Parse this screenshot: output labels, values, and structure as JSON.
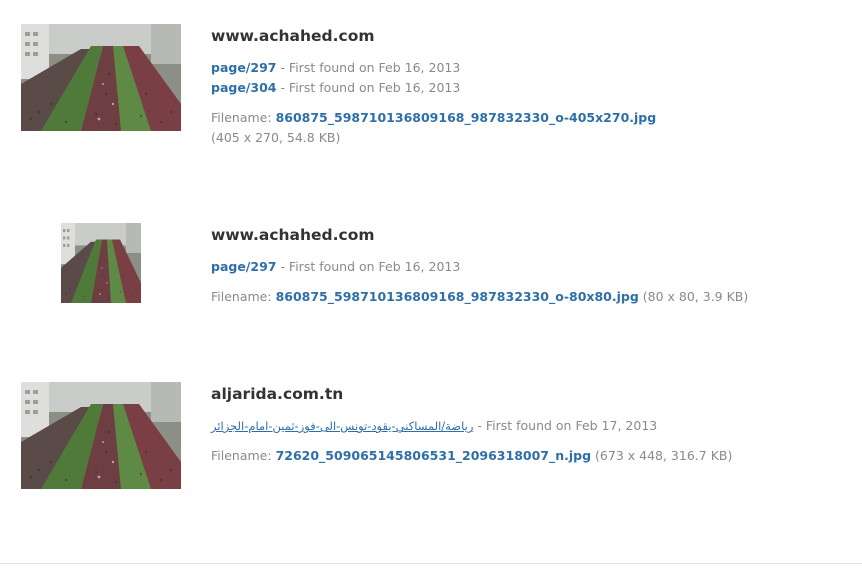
{
  "results": [
    {
      "domain": "www.achahed.com",
      "pages": [
        {
          "link": "page/297",
          "found": " - First found on Feb 16, 2013"
        },
        {
          "link": "page/304",
          "found": " - First found on Feb 16, 2013"
        }
      ],
      "filename_label": "Filename: ",
      "filename": "860875_598710136809168_987832330_o-405x270.jpg",
      "meta": "(405 x 270, 54.8 KB)"
    },
    {
      "domain": "www.achahed.com",
      "pages": [
        {
          "link": "page/297",
          "found": " - First found on Feb 16, 2013"
        }
      ],
      "filename_label": "Filename: ",
      "filename": "860875_598710136809168_987832330_o-80x80.jpg",
      "meta": " (80 x 80, 3.9 KB)"
    },
    {
      "domain": "aljarida.com.tn",
      "pages": [
        {
          "link": "رياضة/المساكني-يقود-تونس-الى-فوز-ثمين-امام-الجزائر",
          "found": " - First found on Feb 17, 2013"
        }
      ],
      "filename_label": "Filename: ",
      "filename": "72620_509065145806531_2096318007_n.jpg",
      "meta": " (673 x 448, 316.7 KB)"
    }
  ],
  "thumbnail_icon": "crowd-photo-thumbnail",
  "colors": {
    "link": "#2f6fa8",
    "muted": "#8a8a8a",
    "domain": "#333333"
  }
}
